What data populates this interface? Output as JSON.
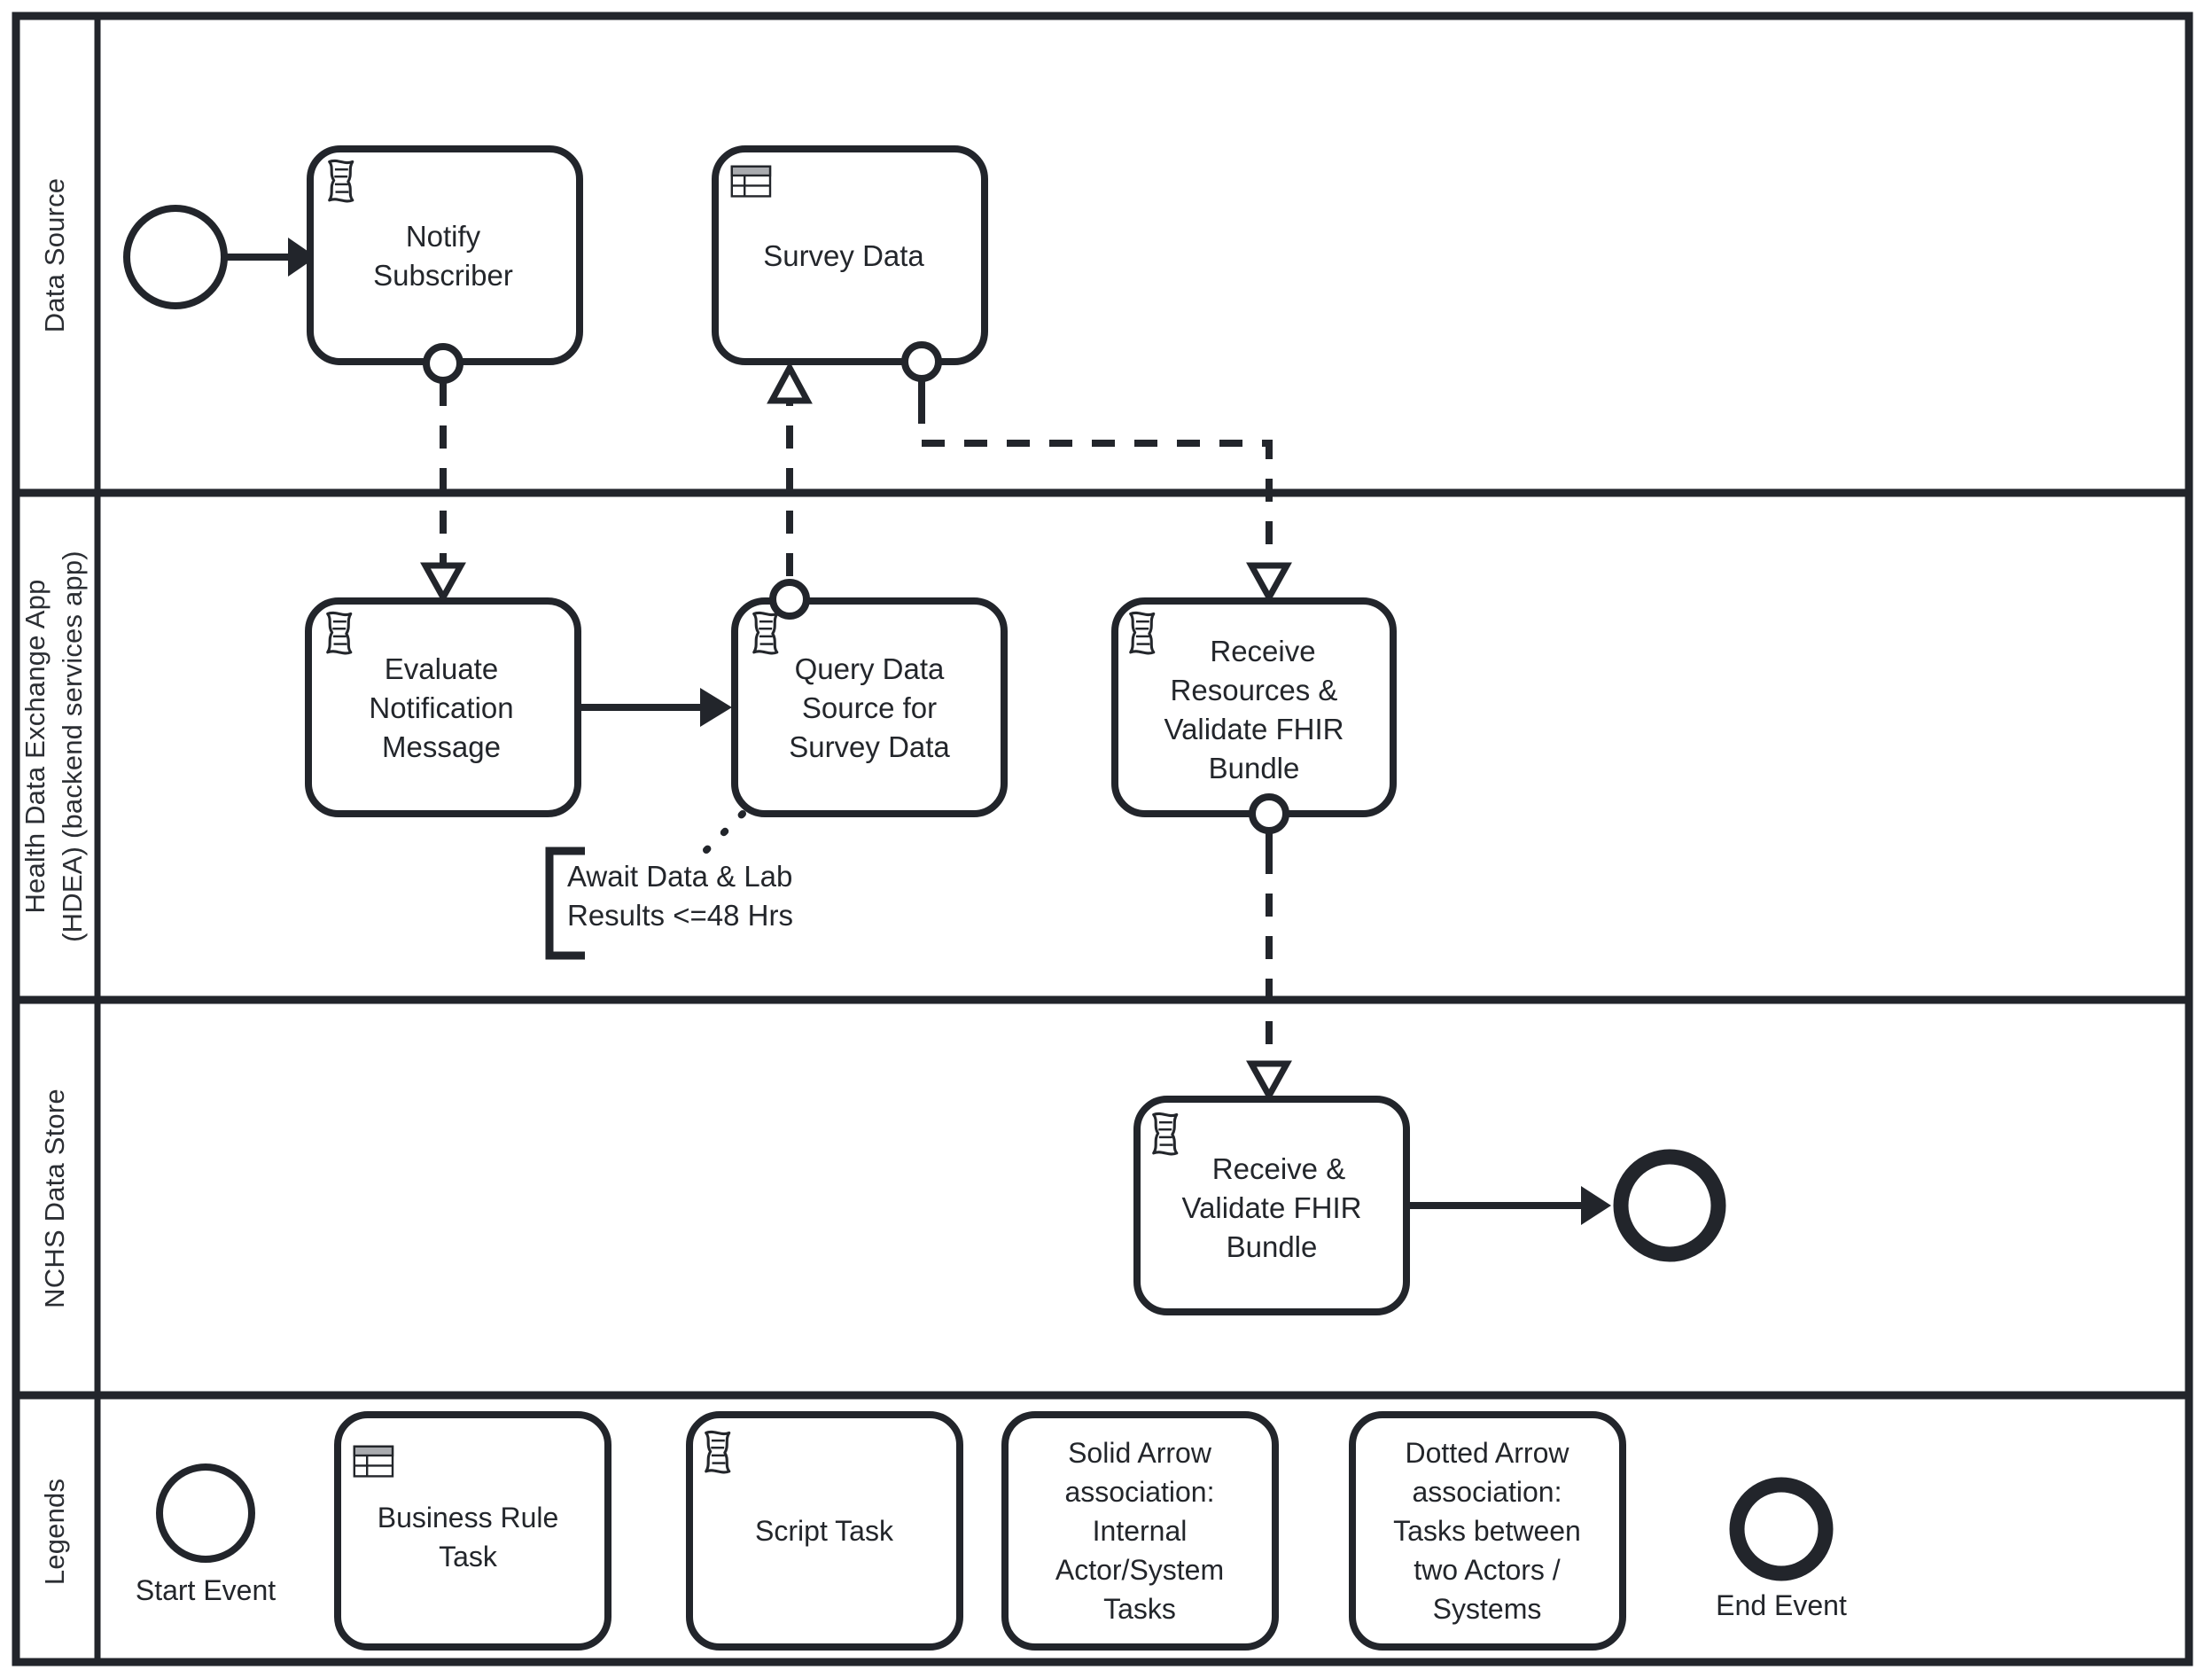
{
  "diagram": {
    "title": "Health Data Exchange BPMN Collaboration Diagram",
    "type": "bpmn-pool-lanes",
    "stroke_color": "#22252b",
    "background_color": "#ffffff",
    "icon_header_fill": "#a9abaf"
  },
  "lanes": [
    {
      "id": "data-source",
      "label": "Data Source"
    },
    {
      "id": "hdea",
      "label_line1": "Health Data Exchange App",
      "label_line2": "(HDEA) (backend services app)"
    },
    {
      "id": "nchs",
      "label": "NCHS Data Store"
    },
    {
      "id": "legends",
      "label": "Legends"
    }
  ],
  "nodes": {
    "start_event": {
      "name": "start-event",
      "type": "start-event"
    },
    "notify_subscriber": {
      "line1": "Notify",
      "line2": "Subscriber",
      "icon": "script-task-icon",
      "lane": "data-source"
    },
    "survey_data": {
      "line1": "Survey Data",
      "icon": "business-rule-task-icon",
      "lane": "data-source"
    },
    "evaluate_notification": {
      "line1": "Evaluate",
      "line2": "Notification",
      "line3": "Message",
      "icon": "script-task-icon",
      "lane": "hdea"
    },
    "query_data_source": {
      "line1": "Query Data",
      "line2": "Source for",
      "line3": "Survey Data",
      "icon": "script-task-icon",
      "lane": "hdea"
    },
    "receive_resources": {
      "line1": "Receive",
      "line2": "Resources &",
      "line3": "Validate FHIR",
      "line4": "Bundle",
      "icon": "script-task-icon",
      "lane": "hdea"
    },
    "receive_validate": {
      "line1": "Receive &",
      "line2": "Validate FHIR",
      "line3": "Bundle",
      "icon": "script-task-icon",
      "lane": "nchs"
    },
    "end_event": {
      "name": "end-event",
      "type": "end-event"
    }
  },
  "annotation": {
    "line1": "Await Data & Lab",
    "line2": "Results <=48 Hrs"
  },
  "legends": {
    "start_event_label": "Start Event",
    "business_rule": {
      "line1": "Business Rule",
      "line2": "Task",
      "icon": "business-rule-task-icon"
    },
    "script_task": {
      "line1": "Script Task",
      "icon": "script-task-icon"
    },
    "solid_arrow": {
      "line1": "Solid Arrow",
      "line2": "association:",
      "line3": "Internal",
      "line4": "Actor/System",
      "line5": "Tasks"
    },
    "dotted_arrow": {
      "line1": "Dotted Arrow",
      "line2": "association:",
      "line3": "Tasks between",
      "line4": "two Actors /",
      "line5": "Systems"
    },
    "end_event_label": "End Event"
  },
  "flows": [
    {
      "name": "start-to-notify",
      "style": "solid",
      "from": "start_event",
      "to": "notify_subscriber"
    },
    {
      "name": "notify-to-evaluate",
      "style": "dashed",
      "from": "notify_subscriber",
      "to": "evaluate_notification"
    },
    {
      "name": "evaluate-to-query",
      "style": "solid",
      "from": "evaluate_notification",
      "to": "query_data_source"
    },
    {
      "name": "query-to-survey-data",
      "style": "dashed",
      "from": "query_data_source",
      "to": "survey_data"
    },
    {
      "name": "survey-data-to-receive-resources",
      "style": "dashed",
      "from": "survey_data",
      "to": "receive_resources"
    },
    {
      "name": "query-to-annotation",
      "style": "dotted",
      "from": "query_data_source",
      "to": "annotation"
    },
    {
      "name": "receive-resources-to-receive-validate",
      "style": "dashed",
      "from": "receive_resources",
      "to": "receive_validate"
    },
    {
      "name": "receive-validate-to-end",
      "style": "solid",
      "from": "receive_validate",
      "to": "end_event"
    }
  ]
}
